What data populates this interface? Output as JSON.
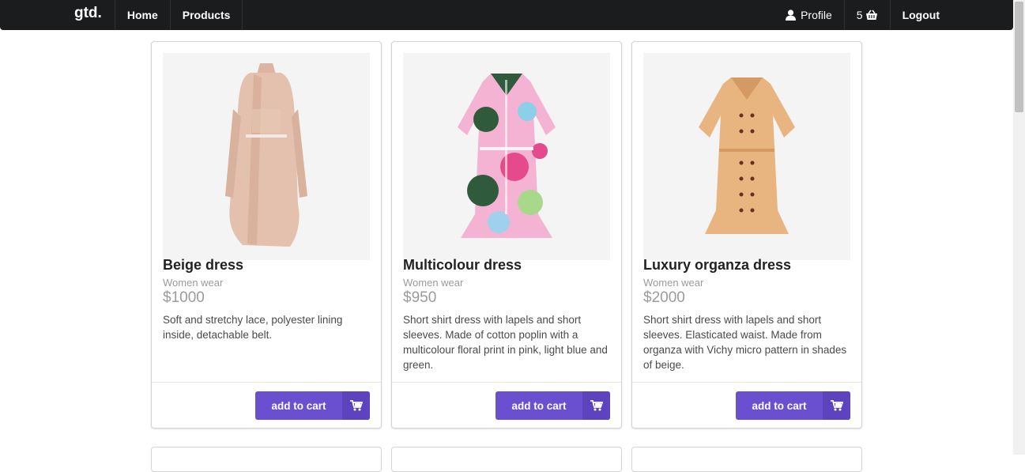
{
  "nav": {
    "brand": "gtd.",
    "home": "Home",
    "products": "Products",
    "profile": "Profile",
    "basket_count": "5",
    "logout": "Logout"
  },
  "products": [
    {
      "title": "Beige dress",
      "category": "Women wear",
      "price": "$1000",
      "description": "Soft and stretchy lace, polyester lining inside, detachable belt.",
      "button": "add to cart"
    },
    {
      "title": "Multicolour dress",
      "category": "Women wear",
      "price": "$950",
      "description": "Short shirt dress with lapels and short sleeves. Made of cotton poplin with a multicolour floral print in pink, light blue and green.",
      "button": "add to cart"
    },
    {
      "title": "Luxury organza dress",
      "category": "Women wear",
      "price": "$2000",
      "description": "Short shirt dress with lapels and short sleeves. Elasticated waist. Made from organza with Vichy micro pattern in shades of beige.",
      "button": "add to cart"
    }
  ],
  "colors": {
    "navbar": "#1b1c1d",
    "accent": "#6a4fcf",
    "accent_dark": "#5d43bd"
  },
  "icons": [
    "user-icon",
    "basket-icon",
    "cart-icon"
  ]
}
